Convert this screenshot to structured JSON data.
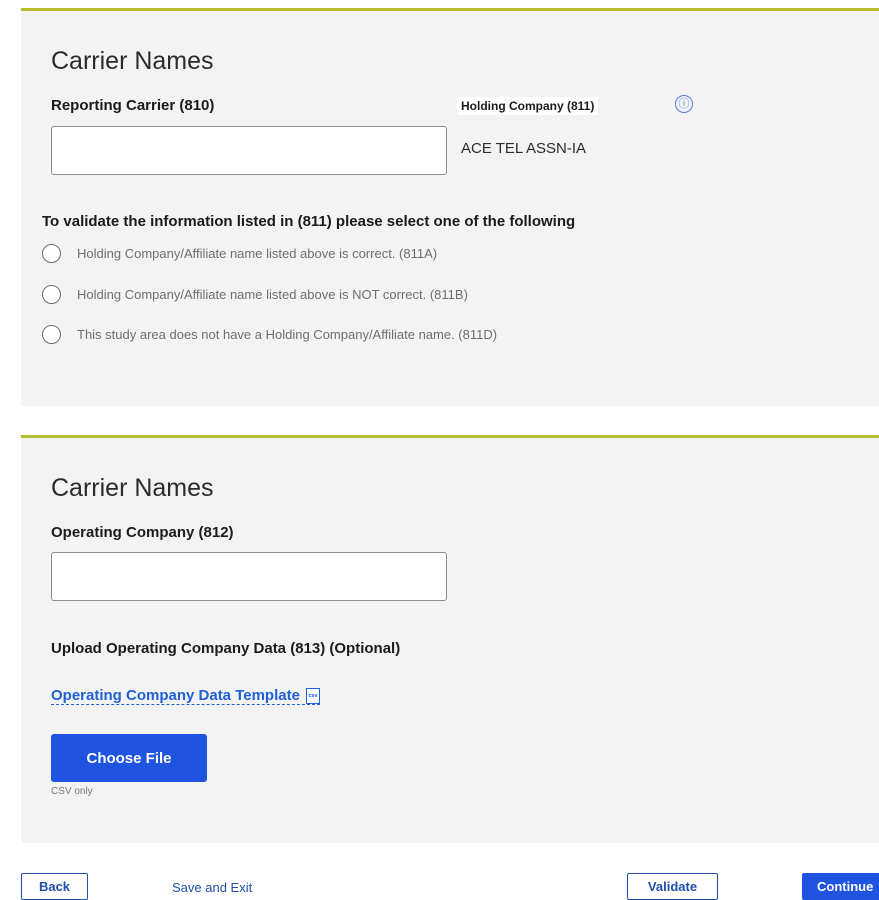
{
  "card1": {
    "title": "Carrier Names",
    "reporting_carrier_label": "Reporting Carrier (810)",
    "reporting_carrier_value": "",
    "holding_company_label": "Holding Company (811)",
    "holding_company_value": "ACE TEL ASSN-IA",
    "info_icon": "ⓘ",
    "validate_heading": "To validate the information listed in (811) please select one of the following",
    "options": [
      "Holding Company/Affiliate name listed above is correct. (811A)",
      "Holding Company/Affiliate name listed above is NOT correct. (811B)",
      "This study area does not have a Holding Company/Affiliate name. (811D)"
    ]
  },
  "card2": {
    "title": "Carrier Names",
    "operating_company_label": "Operating Company (812)",
    "operating_company_value": "",
    "upload_label": "Upload Operating Company Data (813) (Optional)",
    "template_link": "Operating Company Data Template",
    "choose_file": "Choose File",
    "csv_only": "CSV only"
  },
  "footer": {
    "back": "Back",
    "save_exit": "Save and Exit",
    "validate": "Validate",
    "continue": "Continue"
  },
  "colors": {
    "accent_border": "#b5bd2e",
    "primary": "#1f54e0",
    "link": "#1f5fd8"
  }
}
